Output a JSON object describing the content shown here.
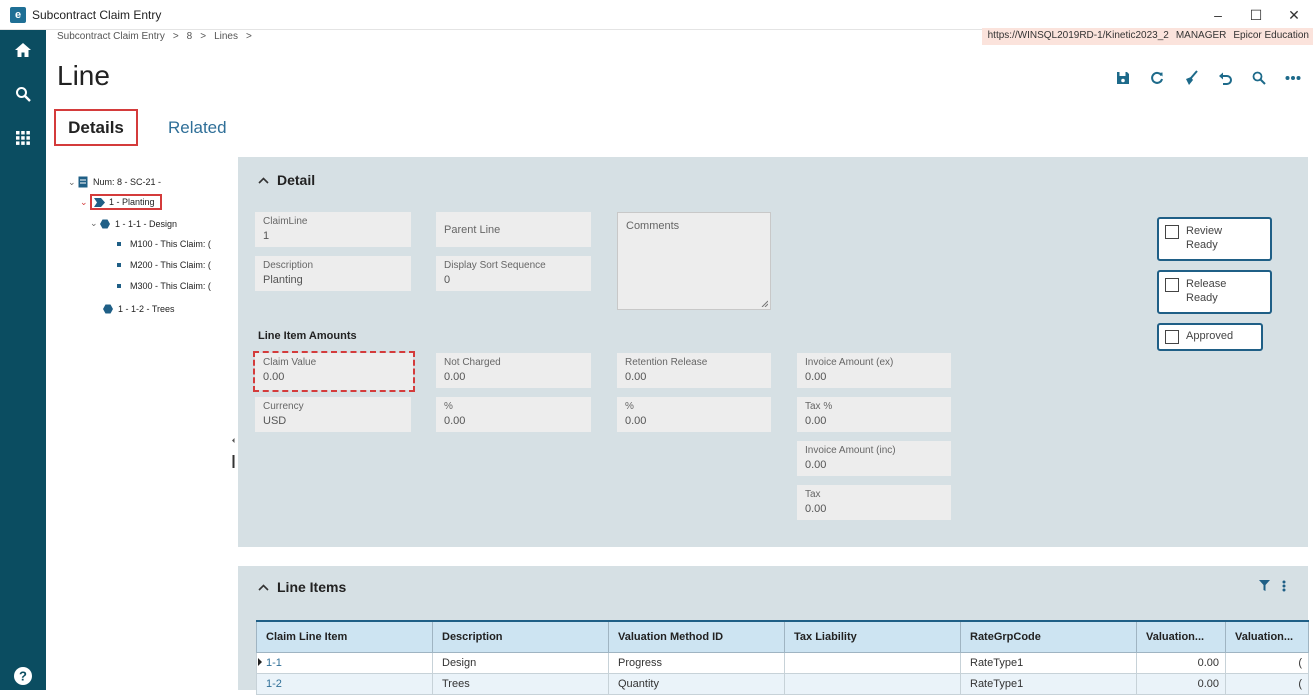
{
  "window": {
    "title": "Subcontract Claim Entry",
    "logo": "e",
    "minimize": "–",
    "maximize": "☐",
    "close": "✕"
  },
  "breadcrumb": [
    "Subcontract Claim Entry",
    ">",
    "8",
    ">",
    "Lines",
    ">"
  ],
  "env": {
    "url": "https://WINSQL2019RD-1/Kinetic2023_2",
    "user": "MANAGER",
    "company": "Epicor Education"
  },
  "page": {
    "title": "Line"
  },
  "tabs": {
    "details": "Details",
    "related": "Related"
  },
  "tree": {
    "root": "Num: 8 - SC-21 -",
    "planting": "1 - Planting",
    "design": "1 - 1-1 - Design",
    "m100": "M100 - This Claim: (",
    "m200": "M200 - This Claim: (",
    "m300": "M300 - This Claim: (",
    "trees": "1 - 1-2 - Trees"
  },
  "detail": {
    "title": "Detail",
    "claim_line": {
      "label": "ClaimLine",
      "value": "1"
    },
    "parent_line": {
      "label": "Parent Line"
    },
    "comments": {
      "label": "Comments"
    },
    "description": {
      "label": "Description",
      "value": "Planting"
    },
    "display_sort": {
      "label": "Display Sort Sequence",
      "value": "0"
    },
    "line_item_amounts": "Line Item Amounts",
    "claim_value": {
      "label": "Claim Value",
      "value": "0.00"
    },
    "not_charged": {
      "label": "Not Charged",
      "value": "0.00"
    },
    "retention_release": {
      "label": "Retention Release",
      "value": "0.00"
    },
    "invoice_amount_ex": {
      "label": "Invoice Amount (ex)",
      "value": "0.00"
    },
    "currency": {
      "label": "Currency",
      "value": "USD"
    },
    "pct1": {
      "label": "%",
      "value": "0.00"
    },
    "pct2": {
      "label": "%",
      "value": "0.00"
    },
    "tax_pct": {
      "label": "Tax %",
      "value": "0.00"
    },
    "invoice_amount_inc": {
      "label": "Invoice Amount (inc)",
      "value": "0.00"
    },
    "tax": {
      "label": "Tax",
      "value": "0.00"
    },
    "review_ready": {
      "line1": "Review",
      "line2": "Ready",
      "checked": false
    },
    "release_ready": {
      "line1": "Release",
      "line2": "Ready",
      "checked": false
    },
    "approved": {
      "line1": "Approved",
      "checked": false
    }
  },
  "line_items": {
    "title": "Line Items",
    "columns": [
      "Claim Line Item",
      "Description",
      "Valuation Method ID",
      "Tax Liability",
      "RateGrpCode",
      "Valuation...",
      "Valuation..."
    ],
    "rows": [
      [
        "1-1",
        "Design",
        "Progress",
        "",
        "RateType1",
        "0.00",
        "("
      ],
      [
        "1-2",
        "Trees",
        "Quantity",
        "",
        "RateType1",
        "0.00",
        "("
      ]
    ]
  },
  "icons": [
    "home-icon",
    "search-icon",
    "apps-grid-icon",
    "help-icon",
    "save-icon",
    "refresh-icon",
    "clear-icon",
    "undo-icon",
    "search-icon",
    "more-icon",
    "filter-icon",
    "kebab-icon"
  ],
  "colors": {
    "rail": "#0b4d61",
    "panel": "#d6e0e4",
    "highlight": "#d43b3b",
    "accent": "#1f5f86"
  }
}
